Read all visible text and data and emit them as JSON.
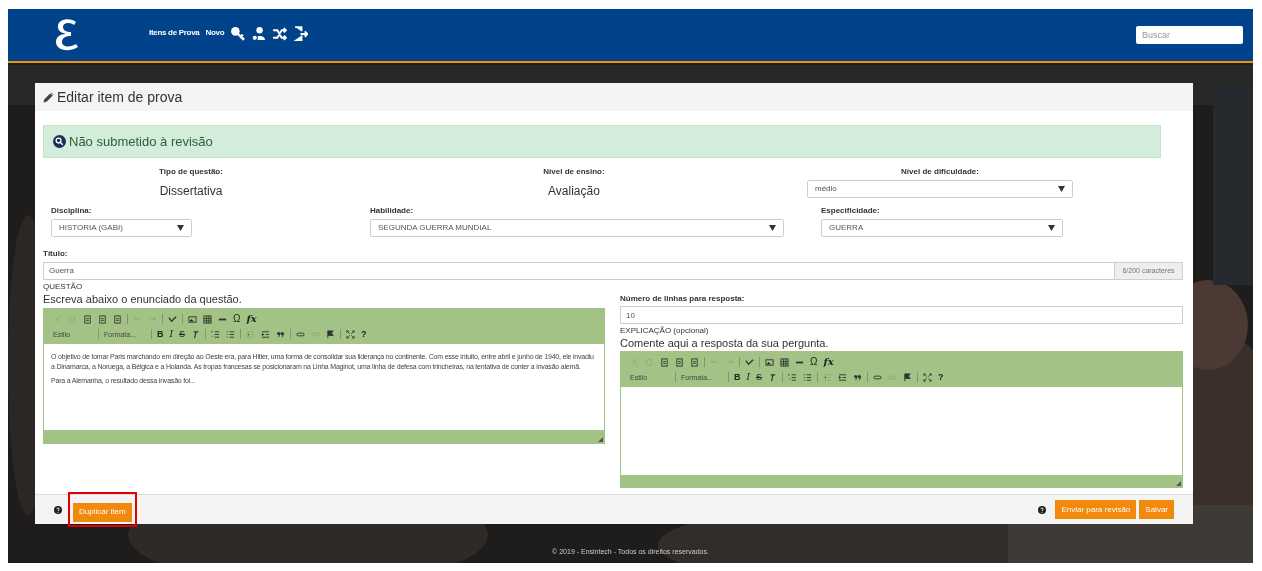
{
  "header": {
    "nav": [
      "Itens de Prova",
      "Novo"
    ],
    "search": {
      "placeholder": "Buscar"
    }
  },
  "card": {
    "title": "Editar item de prova",
    "alert": "Não submetido à revisão",
    "info": [
      {
        "label": "Tipo de questão:",
        "value": "Dissertativa"
      },
      {
        "label": "Nível de ensino:",
        "value": "Avaliação"
      }
    ],
    "difficulty": {
      "label": "Nível de dificuldade:",
      "value": "médio"
    },
    "selects": [
      {
        "label": "Disciplina:",
        "value": "HISTORIA (GABI)"
      },
      {
        "label": "Habilidade:",
        "value": "SEGUNDA GUERRA MUNDIAL"
      },
      {
        "label": "Especificidade:",
        "value": "GUERRA"
      }
    ],
    "title_field": {
      "label": "Título:",
      "value": "Guerra",
      "counter": "6/200 caracteres"
    },
    "question": {
      "section": "QUESTÃO",
      "hint": "Escreva abaixo o enunciado da questão.",
      "paragraphs": [
        "O objetivo de tomar Paris marchando em direção ao Oeste era, para Hitler, uma forma de consolidar sua liderança no continente. Com esse intuito, entre abril e junho de 1940, ele invadiu a Dinamarca, a Noruega, a Bélgica e a Holanda. As tropas francesas se posicionaram na Linha Maginot, uma linha de defesa com trincheiras, na tentativa de conter a invasão alemã.",
        "Para a Alemanha, o resultado dessa invasão foi..."
      ]
    },
    "lines": {
      "label": "Número de linhas para resposta:",
      "value": "10"
    },
    "explanation": {
      "section": "EXPLICAÇÃO (opcional)",
      "hint": "Comente aqui a resposta da sua pergunta."
    },
    "toolbars": [
      {
        "style": "Estilo",
        "format": "Formata...",
        "bold": "B",
        "italic": "I",
        "strike": "S",
        "omega": "Ω",
        "formula": "fx",
        "help": "?"
      },
      {
        "style": "Estilo",
        "format": "Formata...",
        "bold": "B",
        "italic": "I",
        "strike": "S",
        "omega": "Ω",
        "formula": "fx",
        "help": "?"
      }
    ],
    "footer": {
      "left": [
        {
          "label": "Duplicar item",
          "highlighted": true
        }
      ],
      "right": [
        {
          "label": "Enviar para revisão",
          "highlighted": false
        },
        {
          "label": "Salvar",
          "highlighted": false
        }
      ]
    }
  },
  "copyright": "© 2019 - Ensintech - Todos os direitos reservados."
}
